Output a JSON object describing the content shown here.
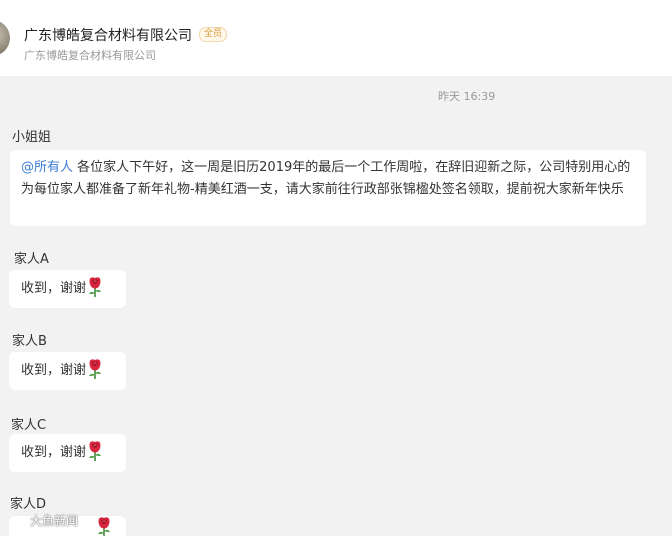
{
  "header": {
    "title": "广东博皓复合材料有限公司",
    "badge": "全员",
    "subtitle": "广东博皓复合材料有限公司"
  },
  "chat": {
    "timestamp": "昨天 16:39",
    "messages": [
      {
        "sender": "小姐姐",
        "mention": "@所有人",
        "text": " 各位家人下午好，这一周是旧历2019年的最后一个工作周啦，在辞旧迎新之际，公司特别用心的为每位家人都准备了新年礼物-精美红酒一支，请大家前往行政部张锦楹处签名领取，提前祝大家新年快乐"
      },
      {
        "sender": "家人A",
        "text": "收到，谢谢",
        "emoji": "rose-emoji"
      },
      {
        "sender": "家人B",
        "text": "收到，谢谢",
        "emoji": "rose-emoji"
      },
      {
        "sender": "家人C",
        "text": "收到，谢谢",
        "emoji": "rose-emoji"
      },
      {
        "sender": "家人D",
        "text": "",
        "emoji": "rose-emoji"
      }
    ]
  },
  "watermark": {
    "text": "大鱼新闻",
    "logo": "watermark-logo-icon"
  },
  "colors": {
    "mention": "#3b7bd6",
    "badge": "#d79b3b",
    "background": "#f2f2f2",
    "bubble": "#ffffff"
  }
}
